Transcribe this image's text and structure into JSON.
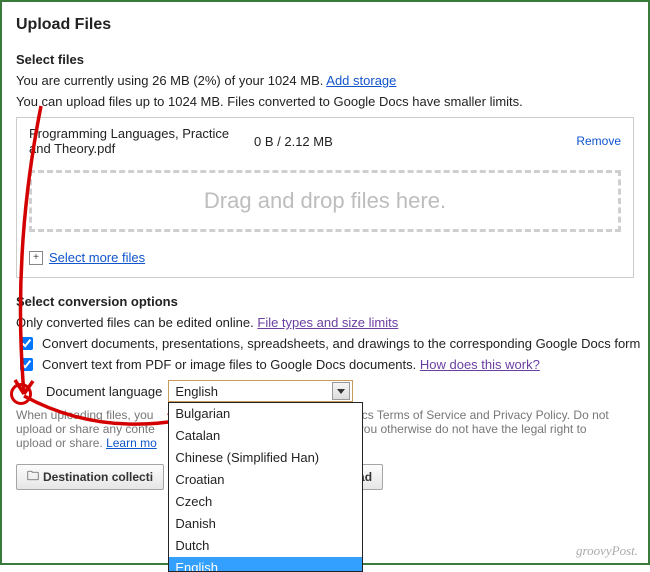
{
  "page_title": "Upload Files",
  "select_files": {
    "header": "Select files",
    "usage_prefix": "You are currently using ",
    "usage_amount": "26 MB (2%)",
    "usage_mid": " of your ",
    "usage_total": "1024 MB",
    "usage_suffix": ". ",
    "add_storage": "Add storage",
    "limit_line": "You can upload files up to 1024 MB. Files converted to Google Docs have smaller limits."
  },
  "file": {
    "name": "Programming Languages, Practice and Theory.pdf",
    "size": "0 B / 2.12 MB",
    "remove": "Remove"
  },
  "dropzone_text": "Drag and drop files here.",
  "select_more": "Select more files",
  "conversion": {
    "header": "Select conversion options",
    "note_prefix": "Only converted files can be edited online. ",
    "note_link": "File types and size limits",
    "opt1": "Convert documents, presentations, spreadsheets, and drawings to the corresponding Google Docs form",
    "opt2_text": "Convert text from PDF or image files to Google Docs documents. ",
    "opt2_link": "How does this work?",
    "lang_label": "Document language",
    "lang_selected": "English",
    "options": [
      "Bulgarian",
      "Catalan",
      "Chinese (Simplified Han)",
      "Croatian",
      "Czech",
      "Danish",
      "Dutch",
      "English"
    ]
  },
  "disclaimer_line1": "When uploading files, you",
  "disclaimer_line1b": "ocs Terms of Service and Privacy Policy. Do not",
  "disclaimer_line2a": "upload or share any conte",
  "disclaimer_line2b": "at you otherwise do not have the legal right to",
  "disclaimer_line3": "upload or share. ",
  "learn_more": "Learn mo",
  "buttons": {
    "dest": "Destination collecti",
    "start": "art upload"
  },
  "watermark": "groovyPost."
}
